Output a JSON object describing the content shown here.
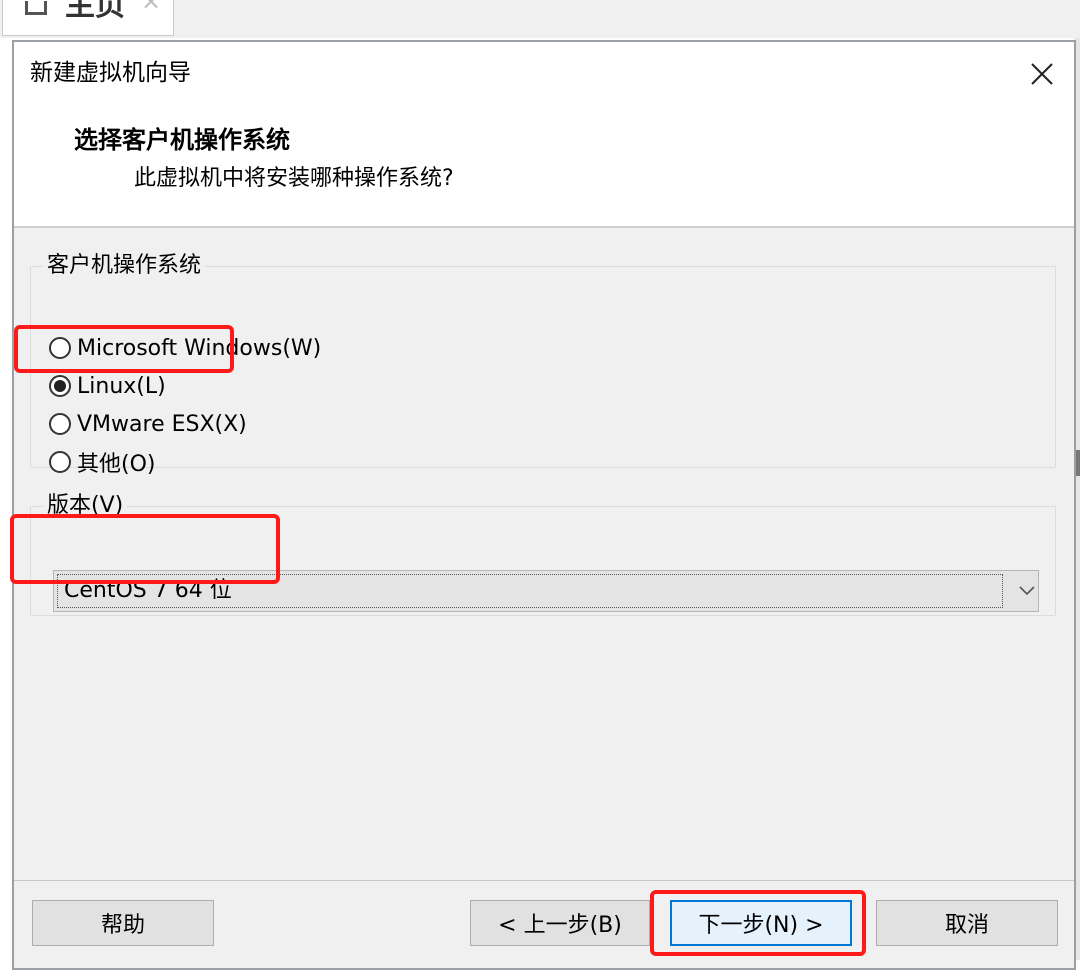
{
  "background_tab": {
    "label": "主页",
    "close_glyph": "×",
    "icon": "home-icon"
  },
  "dialog": {
    "title": "新建虚拟机向导",
    "close_icon": "close-icon"
  },
  "header": {
    "title": "选择客户机操作系统",
    "subtitle": "此虚拟机中将安装哪种操作系统?"
  },
  "os_group": {
    "legend": "客户机操作系统",
    "options": [
      {
        "label": "Microsoft Windows(W)",
        "selected": false
      },
      {
        "label": "Linux(L)",
        "selected": true
      },
      {
        "label": "VMware ESX(X)",
        "selected": false
      },
      {
        "label": "其他(O)",
        "selected": false
      }
    ]
  },
  "version_group": {
    "legend": "版本(V)",
    "selected_value": "CentOS 7 64 位",
    "dropdown_icon": "chevron-down-icon"
  },
  "buttons": {
    "help": "帮助",
    "back": "< 上一步(B)",
    "next": "下一步(N) >",
    "cancel": "取消"
  },
  "colors": {
    "highlight_box": "#ff1a1a",
    "default_button_border": "#0078d7",
    "dialog_background": "#f0f0f0"
  }
}
